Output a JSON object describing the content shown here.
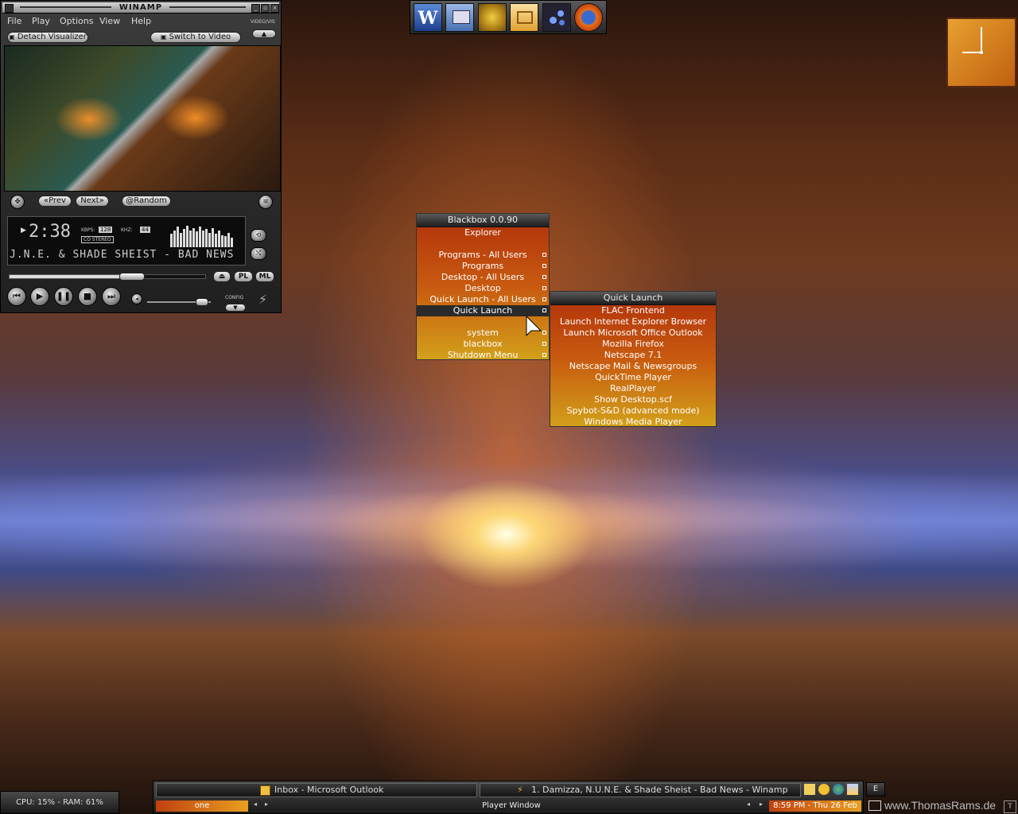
{
  "winamp": {
    "title": "WINAMP",
    "menu": [
      "File",
      "Play",
      "Options",
      "View",
      "Help"
    ],
    "videovis_label": "VIDEO/VIS",
    "detach_label": "Detach Visualizer",
    "switch_label": "Switch to Video",
    "prev_label": "Prev",
    "next_label": "Next",
    "random_label": "Random",
    "time": "2:38",
    "kbps_label": "KBPS:",
    "kbps_value": "128",
    "khz_label": "KHZ:",
    "khz_value": "44",
    "stereo_label": "CO STEREO",
    "track_scroll": "J.N.E. & SHADE SHEIST - BAD NEWS",
    "pl_label": "PL",
    "ml_label": "ML",
    "config_label": "CONFIG",
    "seek_fraction": 0.62,
    "volume_fraction": 0.85
  },
  "dock": {
    "icons": [
      "word-icon",
      "my-computer-icon",
      "gold-emblem-icon",
      "outlook-icon",
      "blue-dots-icon",
      "firefox-icon"
    ],
    "word_glyph": "W"
  },
  "clock": {
    "hour": 9,
    "minute": 0
  },
  "blackbox_menu": {
    "title": "Blackbox 0.0.90",
    "items": [
      {
        "label": "Explorer",
        "submenu": false
      },
      {
        "label": "",
        "submenu": false
      },
      {
        "label": "Programs - All Users",
        "submenu": true
      },
      {
        "label": "Programs",
        "submenu": true
      },
      {
        "label": "Desktop - All Users",
        "submenu": true
      },
      {
        "label": "Desktop",
        "submenu": true
      },
      {
        "label": "Quick Launch - All Users",
        "submenu": true
      },
      {
        "label": "Quick Launch",
        "submenu": true,
        "active": true
      },
      {
        "label": "",
        "submenu": false
      },
      {
        "label": "system",
        "submenu": true
      },
      {
        "label": "blackbox",
        "submenu": true
      },
      {
        "label": "Shutdown Menu",
        "submenu": true
      }
    ]
  },
  "quick_launch_menu": {
    "title": "Quick Launch",
    "items": [
      "FLAC Frontend",
      "Launch Internet Explorer Browser",
      "Launch Microsoft Office Outlook",
      "Mozilla Firefox",
      "Netscape 7.1",
      "Netscape Mail & Newsgroups",
      "QuickTime Player",
      "RealPlayer",
      "Show Desktop.scf",
      "Spybot-S&D (advanced mode)",
      "Windows Media Player"
    ]
  },
  "cpu_widget": {
    "text": "CPU: 15% - RAM: 61%"
  },
  "taskbar": {
    "tasks": [
      {
        "label": "Inbox - Microsoft Outlook",
        "icon": "outlook-icon"
      },
      {
        "label": "1. Damizza, N.U.N.E. & Shade Sheist - Bad News - Winamp",
        "icon": "winamp-icon"
      }
    ],
    "tray_icons": [
      "mail-icon",
      "clock-icon",
      "globe-icon",
      "network-icon"
    ],
    "toolbar_button": "E",
    "workspace": "one",
    "window_label": "Player Window",
    "datetime": "8:59 PM - Thu 26 Feb"
  },
  "watermark": "www.ThomasRams.de"
}
